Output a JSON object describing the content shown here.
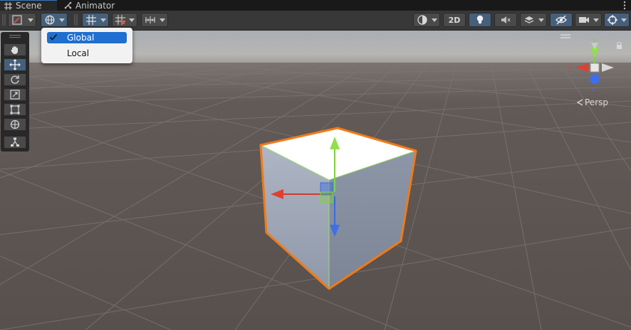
{
  "tabs": [
    {
      "label": "Scene",
      "icon": "grid-icon",
      "active": true
    },
    {
      "label": "Animator",
      "icon": "animator-icon",
      "active": false
    }
  ],
  "toolbar": {
    "left_tools": [
      "gizmo-tool-dropdown",
      "global-handle-dropdown",
      "grid-snap-dropdown",
      "increment-snap-dropdown",
      "ruler-dropdown"
    ],
    "view_2d_label": "2D",
    "right_tools": [
      "shading-mode-dropdown",
      "2d-toggle",
      "lighting-toggle",
      "audio-toggle",
      "effects-dropdown",
      "hidden-objects-toggle",
      "camera-dropdown",
      "gizmos-dropdown"
    ]
  },
  "handle_menu": {
    "items": [
      {
        "label": "Global",
        "checked": true
      },
      {
        "label": "Local",
        "checked": false
      }
    ]
  },
  "tool_palette": [
    "hand-icon",
    "move-icon",
    "rotate-icon",
    "scale-icon",
    "rect-icon",
    "transform-icon",
    "custom-tool-icon"
  ],
  "orientation_gizmo": {
    "axes": [
      "x",
      "y",
      "z"
    ],
    "projection_label": "Persp"
  },
  "colors": {
    "x_axis": "#d23a2a",
    "y_axis": "#7dd140",
    "z_axis": "#3a6be0",
    "selection_outline": "#f07a18",
    "ground": "#5a5350",
    "accent": "#46607c"
  }
}
